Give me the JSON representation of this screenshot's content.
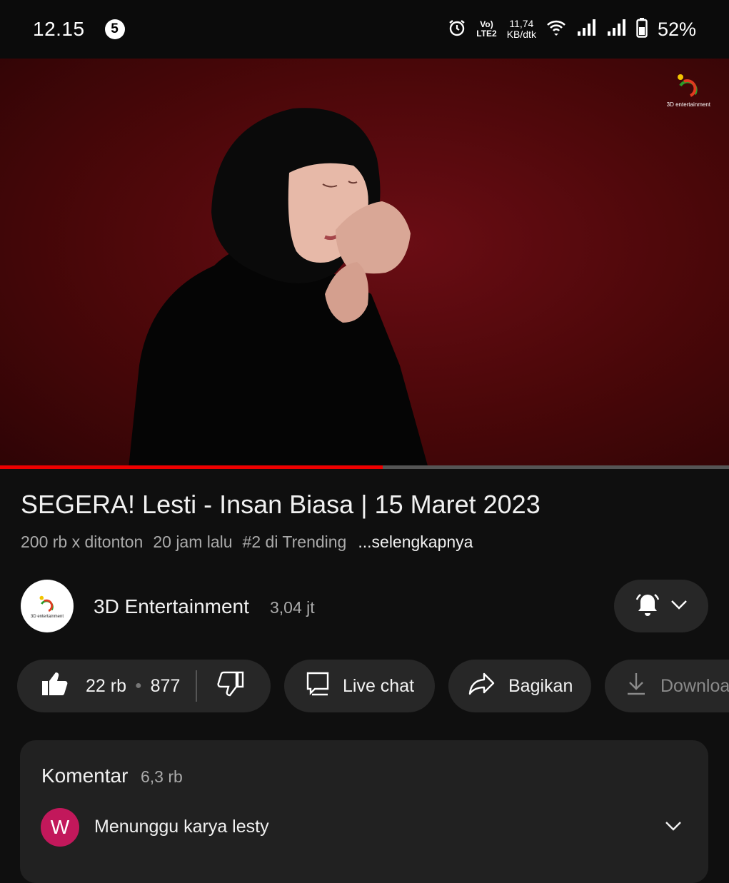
{
  "status_bar": {
    "time": "12.15",
    "notification_badge": "5",
    "network_label_top": "Vo)",
    "network_label_bottom": "LTE2",
    "speed_value": "11,74",
    "speed_unit": "KB/dtk",
    "battery_percent": "52%",
    "icons": [
      "alarm-icon",
      "wifi-icon",
      "signal-icon",
      "signal-icon",
      "battery-icon"
    ]
  },
  "video": {
    "watermark_text": "3D entertainment",
    "progress": 0.525,
    "progress_color": "#ee0000",
    "background_color": "#5a0a10"
  },
  "details": {
    "title": "SEGERA! Lesti - Insan Biasa | 15 Maret 2023",
    "views": "200 rb x ditonton",
    "age": "20 jam lalu",
    "trending": "#2 di Trending",
    "more": "...selengkapnya"
  },
  "channel": {
    "name": "3D Entertainment",
    "subscribers": "3,04 jt",
    "avatar_text": "3D entertainment"
  },
  "actions": {
    "likes": "22 rb",
    "dislikes": "877",
    "live_chat": "Live chat",
    "share": "Bagikan",
    "download": "Download"
  },
  "comments": {
    "title": "Komentar",
    "count": "6,3 rb",
    "first_avatar_letter": "W",
    "first_avatar_color": "#c2185b",
    "first_comment": "Menunggu karya lesty"
  }
}
